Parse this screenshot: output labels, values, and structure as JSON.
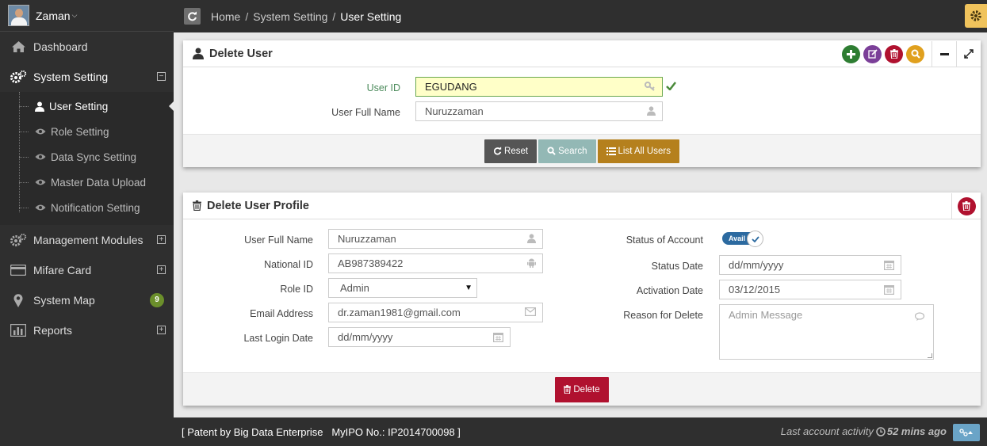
{
  "user": {
    "name": "Zaman"
  },
  "sidebar": {
    "items": [
      {
        "label": "Dashboard"
      },
      {
        "label": "System Setting"
      },
      {
        "label": "Management Modules"
      },
      {
        "label": "Mifare Card"
      },
      {
        "label": "System Map",
        "badge": "9"
      },
      {
        "label": "Reports"
      }
    ],
    "submenu": [
      {
        "label": "User Setting"
      },
      {
        "label": "Role Setting"
      },
      {
        "label": "Data Sync Setting"
      },
      {
        "label": "Master Data Upload"
      },
      {
        "label": "Notification Setting"
      }
    ]
  },
  "breadcrumb": {
    "home": "Home",
    "section": "System Setting",
    "current": "User Setting"
  },
  "search_panel": {
    "title": "Delete User",
    "user_id_label": "User ID",
    "user_id_value": "EGUDANG",
    "full_name_label": "User Full Name",
    "full_name_value": "Nuruzzaman",
    "reset_label": "Reset",
    "search_label": "Search",
    "list_label": "List All Users"
  },
  "profile_panel": {
    "title": "Delete User Profile",
    "full_name_label": "User Full Name",
    "full_name_value": "Nuruzzaman",
    "national_id_label": "National ID",
    "national_id_value": "AB987389422",
    "role_id_label": "Role ID",
    "role_id_value": "Admin",
    "email_label": "Email Address",
    "email_value": "dr.zaman1981@gmail.com",
    "last_login_label": "Last Login Date",
    "last_login_placeholder": "dd/mm/yyyy",
    "status_label": "Status of Account",
    "status_value": "Avail",
    "status_date_label": "Status Date",
    "status_date_placeholder": "dd/mm/yyyy",
    "activation_date_label": "Activation Date",
    "activation_date_value": "03/12/2015",
    "reason_label": "Reason for Delete",
    "reason_placeholder": "Admin Message",
    "delete_label": "Delete"
  },
  "footer": {
    "patent": "[ Patent by Big Data Enterprise   MyIPO No.: IP2014700098 ]",
    "activity_label": "Last account activity",
    "activity_time": "52 mins ago"
  },
  "colors": {
    "sidebar_bg": "#2f2f2f",
    "add": "#2e7d32",
    "edit": "#7b3f98",
    "delete": "#b0112f",
    "search": "#e0a01e",
    "reset_btn": "#555555",
    "search_btn": "#93b8b5",
    "list_btn": "#b5801d",
    "highlight_input": "#ffffc8"
  }
}
